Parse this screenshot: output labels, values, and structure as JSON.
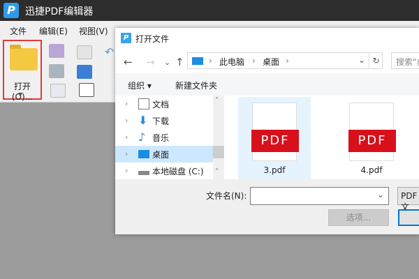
{
  "app": {
    "title": "迅捷PDF编辑器",
    "logo": "P"
  },
  "menu": [
    "文件",
    "编辑(E)",
    "视图(V)"
  ],
  "toolbar": {
    "open_label": "打开(O)...",
    "open_arrow": "▼"
  },
  "dialog": {
    "title": "打开文件",
    "icon": "P",
    "nav": {
      "back": "←",
      "forward": "→",
      "recent": "⌄",
      "up": "↑"
    },
    "address": {
      "parts": [
        "此电脑",
        "桌面"
      ],
      "sep": "›",
      "dropdown": "⌄",
      "refresh": "↻"
    },
    "search_placeholder": "搜索\"桌",
    "commands": {
      "organize": "组织 ▾",
      "new_folder": "新建文件夹"
    },
    "tree": [
      {
        "label": "文档"
      },
      {
        "label": "下载"
      },
      {
        "label": "音乐"
      },
      {
        "label": "桌面",
        "selected": true
      },
      {
        "label": "本地磁盘 (C:)"
      }
    ],
    "tree_chevron": "›",
    "files": [
      {
        "name": "3.pdf",
        "badge": "PDF",
        "selected": true
      },
      {
        "name": "4.pdf",
        "badge": "PDF"
      }
    ],
    "filename_label": "文件名(N):",
    "filename_value": "",
    "filetype": "PDF 文",
    "options_label": "选项...",
    "open_label": "",
    "combo_arrow": "⌄",
    "scroll_up": "˄",
    "scroll_down": "˅"
  }
}
